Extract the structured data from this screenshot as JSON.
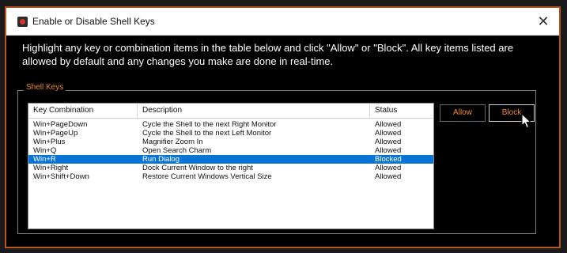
{
  "window": {
    "title": "Enable or Disable Shell Keys",
    "close_glyph": "✕"
  },
  "intro_text": "Highlight any key or combination items in the table below and click \"Allow\" or \"Block\". All key items listed are allowed by default and any changes you make are done in real-time.",
  "group": {
    "label": "Shell Keys"
  },
  "table": {
    "columns": [
      "Key Combination",
      "Description",
      "Status"
    ],
    "rows": [
      {
        "key": "Win+PageDown",
        "description": "Cycle the Shell to the next Right Monitor",
        "status": "Allowed"
      },
      {
        "key": "Win+PageUp",
        "description": "Cycle the Shell to the next Left Monitor",
        "status": "Allowed"
      },
      {
        "key": "Win+Plus",
        "description": "Magnifier Zoom In",
        "status": "Allowed"
      },
      {
        "key": "Win+Q",
        "description": "Open Search Charm",
        "status": "Allowed"
      },
      {
        "key": "Win+R",
        "description": "Run Dialog",
        "status": "Blocked"
      },
      {
        "key": "Win+Right",
        "description": "Dock Current Window to the right",
        "status": "Allowed"
      },
      {
        "key": "Win+Shift+Down",
        "description": "Restore Current Windows Vertical Size",
        "status": "Allowed"
      }
    ],
    "selected_index": 4
  },
  "buttons": {
    "allow": "Allow",
    "block": "Block"
  },
  "colors": {
    "accent": "#f08a24",
    "frame": "#b5541f",
    "selection": "#0a74d6"
  }
}
